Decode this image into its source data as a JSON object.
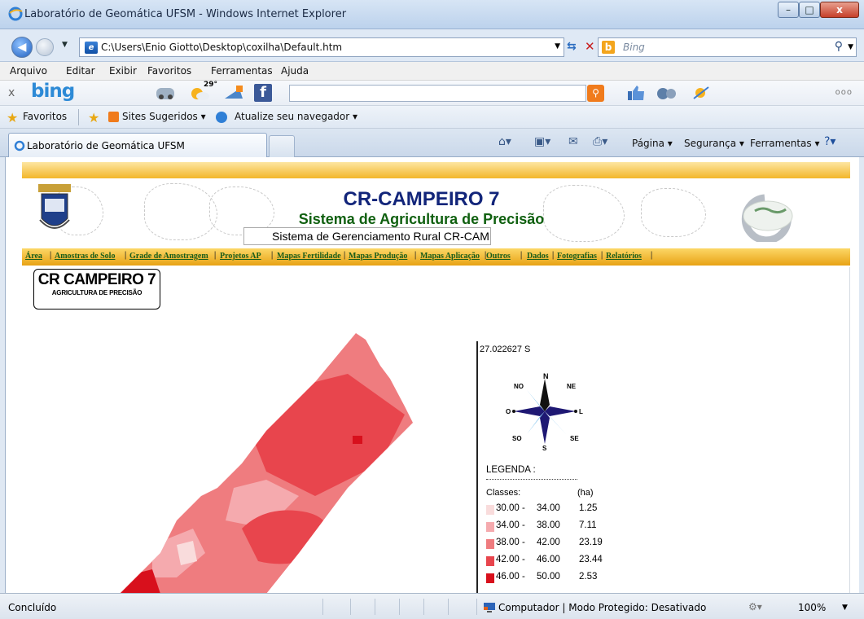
{
  "window": {
    "title": "Laboratório de Geomática UFSM - Windows Internet Explorer",
    "minimize": "–",
    "maximize": "□",
    "close": "x"
  },
  "address": {
    "url": "C:\\Users\\Enio Giotto\\Desktop\\coxilha\\Default.htm",
    "search_placeholder": "Bing"
  },
  "menu": [
    "Arquivo",
    "Editar",
    "Exibir",
    "Favoritos",
    "Ferramentas",
    "Ajuda"
  ],
  "bing_toolbar": {
    "logo": "bing",
    "close": "x",
    "weather_temp": "29°",
    "more": "ooo"
  },
  "favorites_bar": {
    "favorites": "Favoritos",
    "suggested_sites": "Sites Sugeridos ▾",
    "update_browser": "Atualize seu navegador ▾"
  },
  "tab": {
    "label": "Laboratório de Geomática UFSM"
  },
  "command_bar": {
    "page": "Página ▾",
    "security": "Segurança ▾",
    "tools": "Ferramentas ▾"
  },
  "site": {
    "title": "CR-CAMPEIRO 7",
    "subtitle": "Sistema de Agricultura de Precisão",
    "system_box": "Sistema de Gerenciamento Rural CR-CAMPEIRO",
    "nav": [
      "Área",
      "Amostras de Solo",
      "Grade de Amostragem",
      "Projetos AP",
      "Mapas Fertilidade",
      "Mapas Produção",
      "Mapas Aplicação",
      "Outros",
      "Dados",
      "Fotografias",
      "Relatórios"
    ],
    "logo_line1": "CR CAMPEIRO 7",
    "logo_line2": "AGRICULTURA DE PRECISÃO"
  },
  "map": {
    "coordinate": "27.022627 S",
    "compass": {
      "n": "N",
      "ne": "NE",
      "l": "L",
      "se": "SE",
      "s": "S",
      "so": "SO",
      "o": "O",
      "no": "NO"
    },
    "legend_title": "LEGENDA :",
    "classes_label": "Classes:",
    "ha_label": "(ha)",
    "legend": [
      {
        "from": "30.00 -",
        "to": "34.00",
        "ha": "1.25",
        "color": "#f9dcdc"
      },
      {
        "from": "34.00 -",
        "to": "38.00",
        "ha": "7.11",
        "color": "#f5aaae"
      },
      {
        "from": "38.00 -",
        "to": "42.00",
        "ha": "23.19",
        "color": "#ef7c7f"
      },
      {
        "from": "42.00 -",
        "to": "46.00",
        "ha": "23.44",
        "color": "#e8454d"
      },
      {
        "from": "46.00 -",
        "to": "50.00",
        "ha": "2.53",
        "color": "#d8101c"
      }
    ]
  },
  "status": {
    "text": "Concluído",
    "zone": "Computador | Modo Protegido: Desativado",
    "zoom": "100%"
  }
}
